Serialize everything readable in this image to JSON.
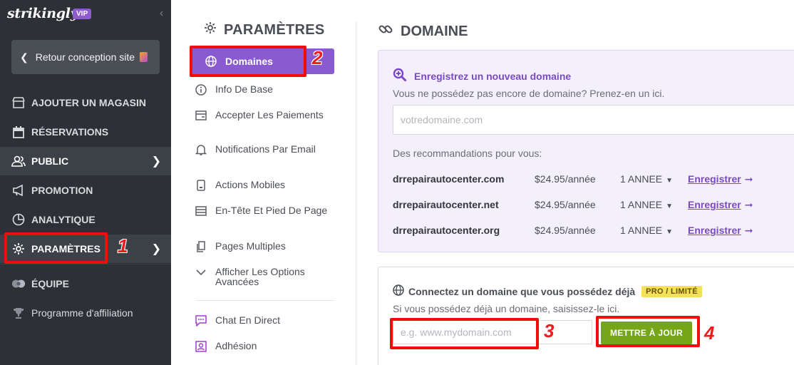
{
  "sidebar": {
    "brand": "strikingly",
    "badge": "VIP",
    "back_label": "Retour conception site",
    "items": [
      {
        "label": "AJOUTER UN MAGASIN",
        "icon": "store-icon"
      },
      {
        "label": "RÉSERVATIONS",
        "icon": "calendar-icon"
      },
      {
        "label": "PUBLIC",
        "icon": "users-icon"
      },
      {
        "label": "PROMOTION",
        "icon": "megaphone-icon"
      },
      {
        "label": "ANALYTIQUE",
        "icon": "pie-chart-icon"
      },
      {
        "label": "PARAMÈTRES",
        "icon": "gear-icon"
      },
      {
        "label": "ÉQUIPE",
        "icon": "team-icon"
      },
      {
        "label": "Programme d'affiliation",
        "icon": "trophy-icon"
      }
    ]
  },
  "settings": {
    "title": "PARAMÈTRES",
    "items": [
      {
        "label": "Domaines",
        "icon": "globe-icon"
      },
      {
        "label": "Info De Base",
        "icon": "info-icon"
      },
      {
        "label": "Accepter Les Paiements",
        "icon": "wallet-icon"
      },
      {
        "label": "Notifications Par Email",
        "icon": "bell-icon"
      },
      {
        "label": "Actions Mobiles",
        "icon": "mobile-icon"
      },
      {
        "label": "En-Tête Et Pied De Page",
        "icon": "layout-icon"
      },
      {
        "label": "Pages Multiples",
        "icon": "pages-icon"
      },
      {
        "label": "Afficher Les Options Avancées",
        "icon": "chevron-down-icon"
      },
      {
        "label": "Chat En Direct",
        "icon": "chat-icon"
      },
      {
        "label": "Adhésion",
        "icon": "member-icon"
      }
    ]
  },
  "main": {
    "title": "DOMAINE",
    "register": {
      "heading": "Enregistrez un nouveau domaine",
      "subtitle": "Vous ne possédez pas encore de domaine? Prenez-en un ici.",
      "placeholder": "votredomaine.com",
      "rec_label": "Des recommandations pour vous:",
      "rows": [
        {
          "domain": "drrepairautocenter.com",
          "price": "$24.95/année",
          "plan": "1 ANNEE",
          "action": "Enregistrer"
        },
        {
          "domain": "drrepairautocenter.net",
          "price": "$24.95/année",
          "plan": "1 ANNEE",
          "action": "Enregistrer"
        },
        {
          "domain": "drrepairautocenter.org",
          "price": "$24.95/année",
          "plan": "1 ANNEE",
          "action": "Enregistrer"
        }
      ]
    },
    "connect": {
      "heading": "Connectez un domaine que vous possédez déjà",
      "badge": "PRO / LIMITÉ",
      "subtitle": "Si vous possédez déjà un domaine, saisissez-le ici.",
      "placeholder": "e.g. www.mydomain.com",
      "button": "METTRE À JOUR"
    }
  },
  "annotations": [
    "1",
    "2",
    "3",
    "4"
  ],
  "colors": {
    "sidebar_bg": "#2d3035",
    "accent_purple": "#8a5ad1",
    "update_green": "#74a618",
    "annotation_red": "#f20d0d"
  }
}
